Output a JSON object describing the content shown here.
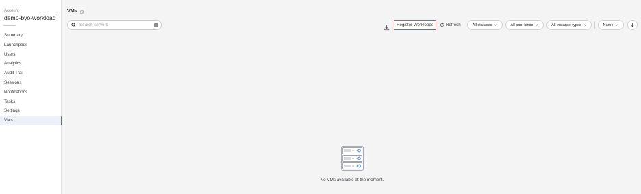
{
  "sidebar": {
    "account_label": "Account",
    "account_name": "demo-byo-workload",
    "items": [
      {
        "label": "Summary"
      },
      {
        "label": "Launchpads"
      },
      {
        "label": "Users"
      },
      {
        "label": "Analytics"
      },
      {
        "label": "Audit Trail"
      },
      {
        "label": "Sessions"
      },
      {
        "label": "Notifications"
      },
      {
        "label": "Tasks"
      },
      {
        "label": "Settings"
      },
      {
        "label": "VMs"
      }
    ],
    "active_item": "VMs"
  },
  "main": {
    "title": "VMs",
    "title_icon": "copy-icon",
    "search": {
      "placeholder": "Search servers",
      "value": ""
    },
    "toolbar": {
      "download_icon": "download-icon",
      "register_label": "Register Workloads",
      "refresh_label": "Refresh",
      "filters": {
        "statuses": "All statuses",
        "pool_kinds": "All pool kinds",
        "instance_types": "All instance types",
        "sort": "Name"
      },
      "sort_direction_icon": "arrow-down-icon"
    },
    "empty_state": {
      "icon": "server-rack-icon",
      "message": "No VMs available at the moment."
    }
  },
  "colors": {
    "accent": "#4f6fd6",
    "highlight_border": "#e04545",
    "icon_blue": "#4a90d9"
  }
}
